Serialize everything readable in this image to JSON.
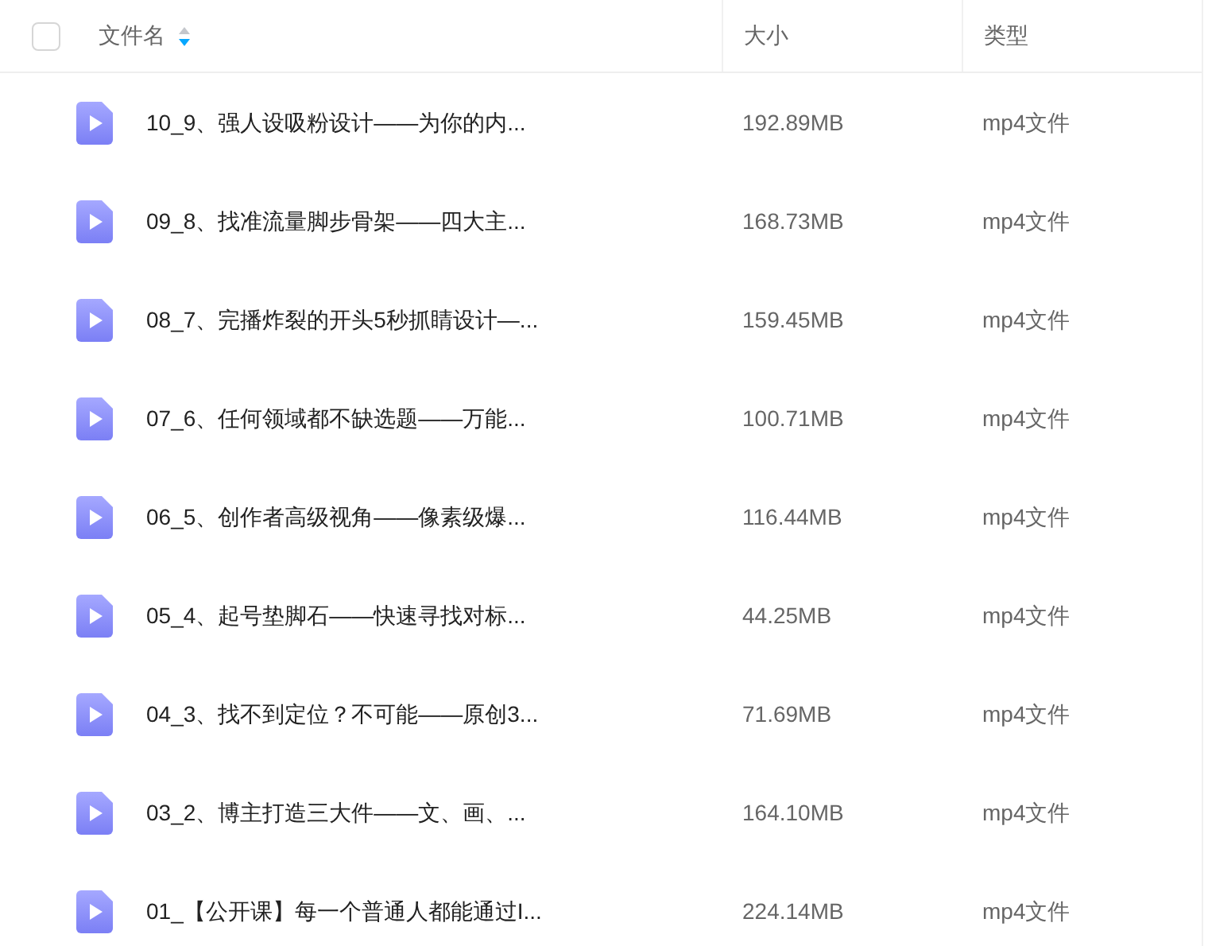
{
  "table": {
    "select_all": {
      "checked": false
    },
    "columns": [
      {
        "label": "文件名",
        "sort_descending": true
      },
      {
        "label": "大小"
      },
      {
        "label": "类型"
      }
    ],
    "rows": [
      {
        "name": "10_9、强人设吸粉设计——为你的内...",
        "size": "192.89MB",
        "type": "mp4文件"
      },
      {
        "name": "09_8、找准流量脚步骨架——四大主...",
        "size": "168.73MB",
        "type": "mp4文件"
      },
      {
        "name": "08_7、完播炸裂的开头5秒抓睛设计—...",
        "size": "159.45MB",
        "type": "mp4文件"
      },
      {
        "name": "07_6、任何领域都不缺选题——万能...",
        "size": "100.71MB",
        "type": "mp4文件"
      },
      {
        "name": "06_5、创作者高级视角——像素级爆...",
        "size": "116.44MB",
        "type": "mp4文件"
      },
      {
        "name": "05_4、起号垫脚石——快速寻找对标...",
        "size": "44.25MB",
        "type": "mp4文件"
      },
      {
        "name": "04_3、找不到定位？不可能——原创3...",
        "size": "71.69MB",
        "type": "mp4文件"
      },
      {
        "name": "03_2、博主打造三大件——文、画、...",
        "size": "164.10MB",
        "type": "mp4文件"
      },
      {
        "name": "01_【公开课】每一个普通人都能通过I...",
        "size": "224.14MB",
        "type": "mp4文件"
      }
    ]
  }
}
